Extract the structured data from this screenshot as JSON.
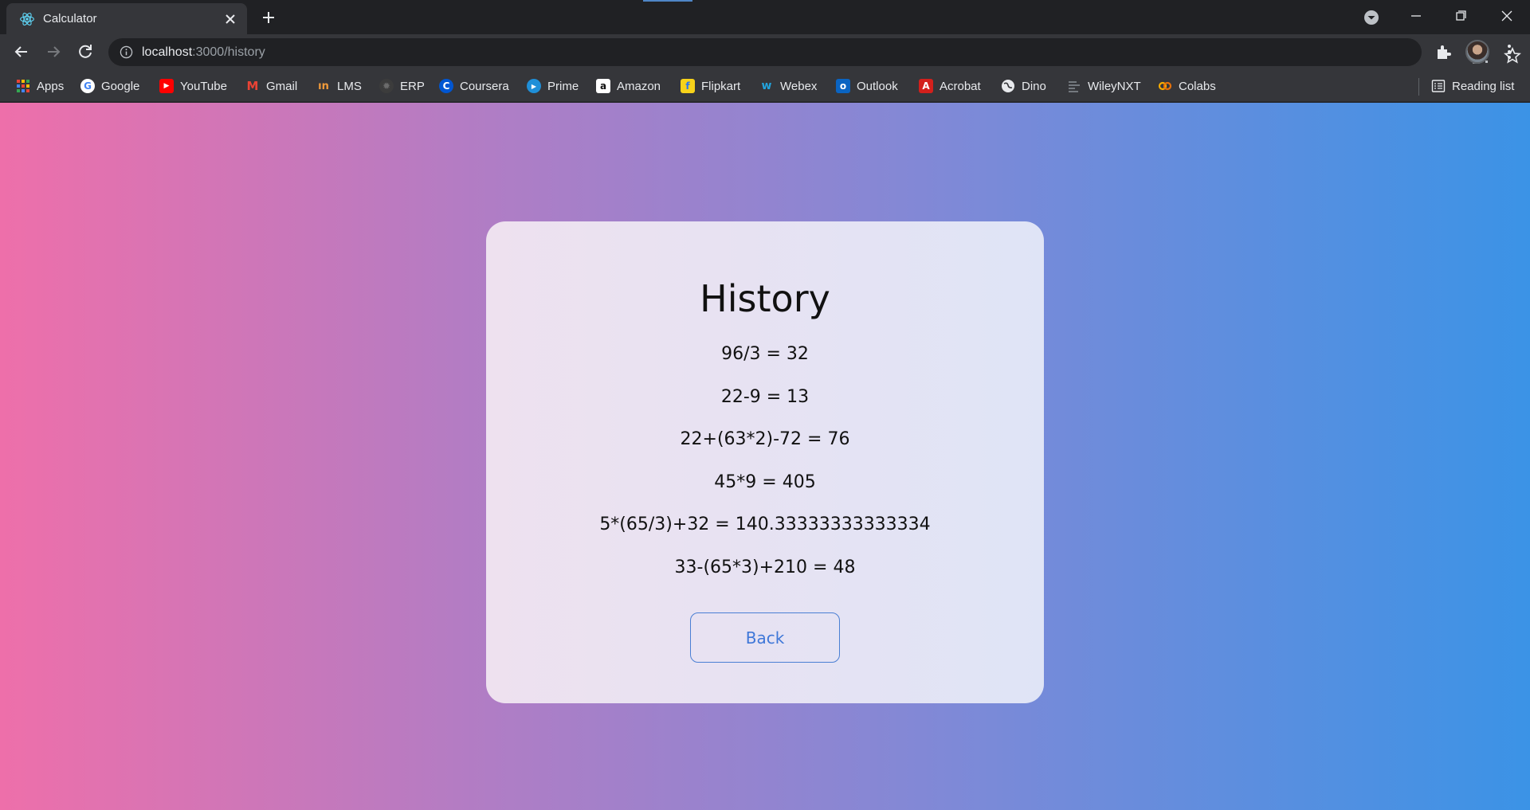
{
  "browser": {
    "tab": {
      "title": "Calculator",
      "favicon": "react-icon"
    },
    "address": {
      "host": "localhost",
      "path": ":3000/history"
    },
    "bookmarks": [
      {
        "label": "Apps",
        "icon": "apps-grid-icon",
        "color": "#ea4335"
      },
      {
        "label": "Google",
        "icon": "google-icon",
        "color": "#4285f4"
      },
      {
        "label": "YouTube",
        "icon": "youtube-icon",
        "color": "#ff0000"
      },
      {
        "label": "Gmail",
        "icon": "gmail-icon",
        "color": "#ea4335"
      },
      {
        "label": "LMS",
        "icon": "lms-icon",
        "color": "#f29b3a"
      },
      {
        "label": "ERP",
        "icon": "erp-icon",
        "color": "#3c3c3c"
      },
      {
        "label": "Coursera",
        "icon": "coursera-icon",
        "color": "#0056d2"
      },
      {
        "label": "Prime",
        "icon": "prime-icon",
        "color": "#1f8fd8"
      },
      {
        "label": "Amazon",
        "icon": "amazon-icon",
        "color": "#232f3e"
      },
      {
        "label": "Flipkart",
        "icon": "flipkart-icon",
        "color": "#f7d21a"
      },
      {
        "label": "Webex",
        "icon": "webex-icon",
        "color": "#22a3dc"
      },
      {
        "label": "Outlook",
        "icon": "outlook-icon",
        "color": "#0a64c2"
      },
      {
        "label": "Acrobat",
        "icon": "acrobat-icon",
        "color": "#d3201c"
      },
      {
        "label": "Dino",
        "icon": "globe-icon",
        "color": "#5f6368"
      },
      {
        "label": "WileyNXT",
        "icon": "wileynxt-icon",
        "color": "#8a8f96"
      },
      {
        "label": "Colabs",
        "icon": "colab-icon",
        "color": "#f9ab00"
      }
    ],
    "reading_list": "Reading list"
  },
  "card": {
    "title": "History",
    "entries": [
      "96/3 = 32",
      "22-9 = 13",
      "22+(63*2)-72 = 76",
      "45*9 = 405",
      "5*(65/3)+32 = 140.33333333333334",
      "33-(65*3)+210 = 48"
    ],
    "back_label": "Back"
  },
  "colors": {
    "accent": "#4a7fd4",
    "gradient_left": "#ee6faa",
    "gradient_right": "#3b93e6"
  }
}
